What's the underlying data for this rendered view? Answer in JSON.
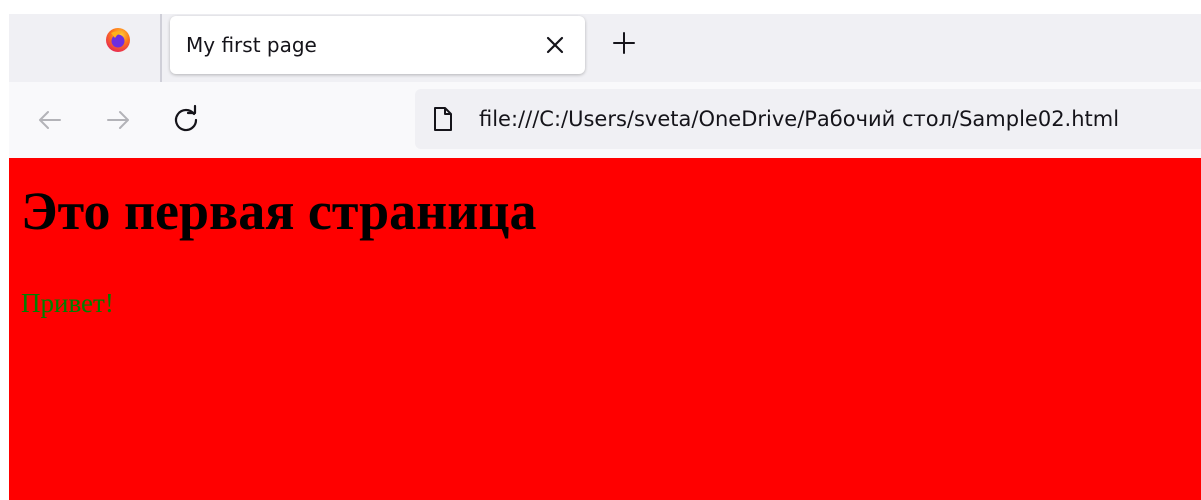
{
  "browser": {
    "tab": {
      "title": "My first page"
    },
    "address_bar": {
      "url": "file:///C:/Users/sveta/OneDrive/Рабочий стол/Sample02.html"
    }
  },
  "page": {
    "background_color": "#ff0000",
    "heading": "Это первая страница",
    "paragraph": "Привет!",
    "paragraph_color": "#008000"
  }
}
